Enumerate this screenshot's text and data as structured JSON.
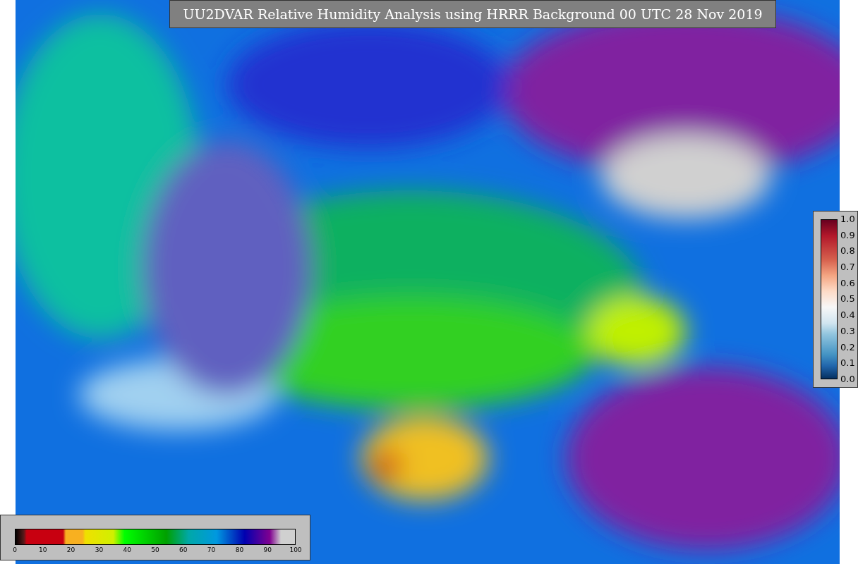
{
  "title": "UU2DVAR Relative Humidity Analysis using HRRR Background 00 UTC 28 Nov 2019",
  "humidity_colorbar": {
    "ticks": [
      "0",
      "10",
      "20",
      "30",
      "40",
      "50",
      "60",
      "70",
      "80",
      "90",
      "100"
    ]
  },
  "fraction_colorbar": {
    "ticks": [
      "1.0",
      "0.9",
      "0.8",
      "0.7",
      "0.6",
      "0.5",
      "0.4",
      "0.3",
      "0.2",
      "0.1",
      "0.0"
    ]
  }
}
